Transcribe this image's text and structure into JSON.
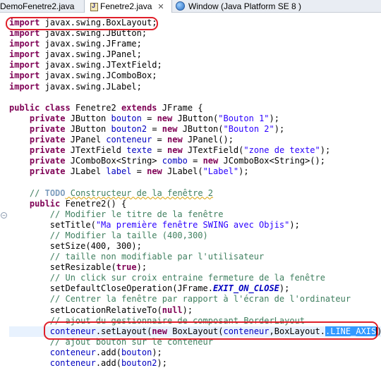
{
  "tabs": [
    {
      "label": "DemoFenetre2.java",
      "active": false
    },
    {
      "label": "Fenetre2.java",
      "active": true,
      "close": "✕"
    },
    {
      "label": "Window (Java Platform SE 8 )",
      "active": false
    }
  ],
  "code": {
    "imports": [
      "javax.swing.BoxLayout;",
      "javax.swing.JButton;",
      "javax.swing.JFrame;",
      "javax.swing.JPanel;",
      "javax.swing.JTextField;",
      "javax.swing.JComboBox;",
      "javax.swing.JLabel;"
    ],
    "import_kw": "import",
    "class_decl": {
      "kw1": "public class",
      "name": " Fenetre2 ",
      "kw2": "extends",
      "rest": " JFrame {"
    },
    "fields": {
      "f1": {
        "kw": "private",
        "a": " JButton ",
        "name": "bouton",
        "b": " = ",
        "new": "new",
        "c": " JButton(",
        "str": "\"Bouton 1\"",
        "d": ");"
      },
      "f2": {
        "kw": "private",
        "a": " JButton ",
        "name": "bouton2",
        "b": " = ",
        "new": "new",
        "c": " JButton(",
        "str": "\"Bouton 2\"",
        "d": ");"
      },
      "f3": {
        "kw": "private",
        "a": " JPanel ",
        "name": "conteneur",
        "b": " = ",
        "new": "new",
        "c": " JPanel();"
      },
      "f4": {
        "kw": "private",
        "a": " JTextField ",
        "name": "texte",
        "b": " = ",
        "new": "new",
        "c": " JTextField(",
        "str": "\"zone de texte\"",
        "d": ");"
      },
      "f5": {
        "kw": "private",
        "a": " JComboBox<String> ",
        "name": "combo",
        "b": " = ",
        "new": "new",
        "c": " JComboBox<String>();"
      },
      "f6": {
        "kw": "private",
        "a": " JLabel ",
        "name": "label",
        "b": " = ",
        "new": "new",
        "c": " JLabel(",
        "str": "\"Label\"",
        "d": ");"
      }
    },
    "todo_comment": {
      "pre": "// ",
      "todo": "TODO",
      "post": " Constructeur de la fenêtre 2"
    },
    "ctor": {
      "kw": "public",
      "rest": " Fenetre2() {"
    },
    "body": {
      "c1": "// Modifier le titre de la fenêtre",
      "s1a": "setTitle(",
      "s1str": "\"Ma première fenêtre SWING avec Objis\"",
      "s1b": ");",
      "c2": "// Modifier la taille (400,300)",
      "s2": "setSize(400, 300);",
      "c3": "// taille non modifiable par l'utilisateur",
      "s3a": "setResizable(",
      "s3kw": "true",
      "s3b": ");",
      "c4": "// Un click sur croix entraine fermeture de la fenêtre",
      "s4a": "setDefaultCloseOperation(JFrame.",
      "s4f": "EXIT_ON_CLOSE",
      "s4b": ");",
      "c5": "// Centrer la fenêtre par rapport à l'écran de l'ordinateur",
      "s5a": "setLocationRelativeTo(",
      "s5kw": "null",
      "s5b": ");",
      "c6": "// ajout du gestionnaire de composant BorderLayout",
      "s6fld": "conteneur",
      "s6a": ".setLayout(",
      "s6kw": "new",
      "s6b": " BoxLayout(",
      "s6fld2": "conteneur",
      "s6c": ",BoxLayout.",
      "s6sel": ".LINE_AXIS",
      "s6d": "));",
      "c7": "// ajout bouton sur le conteneur",
      "s7fld": "conteneur",
      "s7a": ".add(",
      "s7fld2": "bouton",
      "s7b": ");",
      "s8fld": "conteneur",
      "s8a": ".add(",
      "s8fld2": "bouton2",
      "s8b": ");"
    }
  },
  "colors": {
    "annotation": "#e0202a",
    "selection": "#3399ff",
    "keyword": "#7f0055",
    "string": "#2a00ff",
    "comment": "#3f7f5f",
    "field": "#0000c0"
  },
  "icons": [
    "java-file-icon",
    "java-file-icon",
    "browser-globe-icon",
    "close-icon",
    "fold-icon"
  ]
}
